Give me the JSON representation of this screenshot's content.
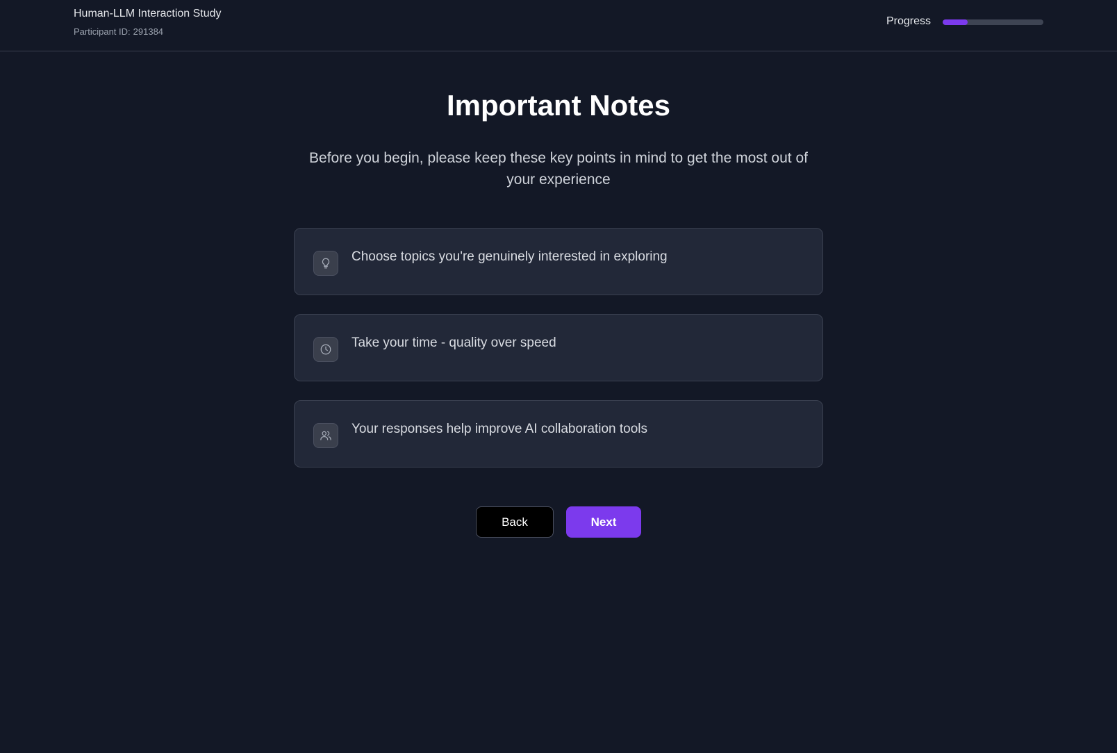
{
  "header": {
    "study_title": "Human-LLM Interaction Study",
    "participant_label": "Participant ID:",
    "participant_id": "291384",
    "progress_label": "Progress",
    "progress_fraction": 0.25
  },
  "main": {
    "title": "Important Notes",
    "subtitle": "Before you begin, please keep these key points in mind to get the most out of your experience",
    "notes": [
      {
        "icon": "lightbulb-icon",
        "text": "Choose topics you're genuinely interested in exploring"
      },
      {
        "icon": "clock-icon",
        "text": "Take your time - quality over speed"
      },
      {
        "icon": "users-icon",
        "text": "Your responses help improve AI collaboration tools"
      }
    ]
  },
  "nav": {
    "back_label": "Back",
    "next_label": "Next"
  },
  "colors": {
    "background": "#131826",
    "accent": "#7c3aed",
    "card": "#222838"
  }
}
